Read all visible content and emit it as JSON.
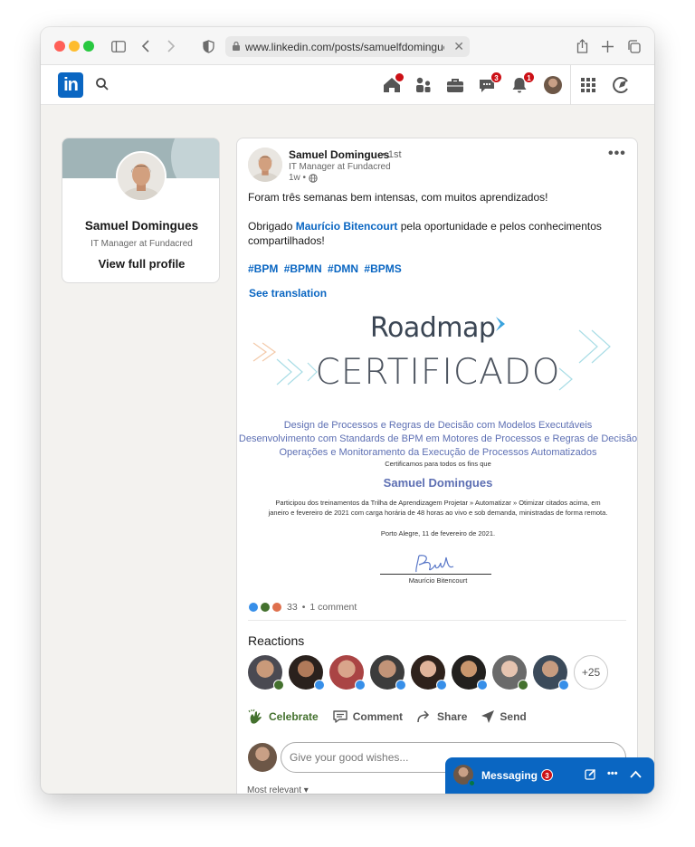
{
  "browser": {
    "url": "www.linkedin.com/posts/samuelfdomingues"
  },
  "nav": {
    "logo": "in",
    "badges": {
      "home": "",
      "messaging": "3",
      "notifications": "1"
    }
  },
  "profile_card": {
    "name": "Samuel Domingues",
    "headline": "IT Manager at Fundacred",
    "view_profile": "View full profile"
  },
  "post": {
    "author_name": "Samuel Domingues",
    "degree": "• 1st",
    "author_headline": "IT Manager at Fundacred",
    "time": "1w •",
    "text_line1": "Foram três semanas bem intensas, com muitos aprendizados!",
    "text_thanks_prefix": "Obrigado ",
    "mention": "Maurício Bitencourt",
    "text_thanks_suffix": " pela oportunidade e pelos conhecimentos",
    "text_thanks_line2": "compartilhados!",
    "hashtags": [
      "#BPM",
      "#BPMN",
      "#DMN",
      "#BPMS"
    ],
    "see_translation": "See translation"
  },
  "certificate": {
    "brand": "Roadmap",
    "title": "CERTIFICADO",
    "course_1": "Design de Processos e Regras de Decisão com Modelos Executáveis",
    "course_2": "Desenvolvimento com Standards de BPM em Motores de Processos e Regras de Decisão",
    "course_3": "Operações e Monitoramento da Execução de Processos Automatizados",
    "intro": "Certificamos para todos os fins que",
    "recipient": "Samuel Domingues",
    "body_1": "Participou dos treinamentos da Trilha de Aprendizagem Projetar » Automatizar » Otimizar citados acima, em",
    "body_2": "janeiro e fevereiro de 2021 com carga horária de 48 horas ao vivo e sob demanda, ministradas de forma remota.",
    "place_date": "Porto Alegre, 11 de fevereiro de 2021.",
    "signer": "Maurício Bitencourt"
  },
  "social": {
    "reaction_count": "33",
    "separator": "•",
    "comments": "1 comment",
    "reactions_heading": "Reactions",
    "more_reactors": "+25"
  },
  "actions": {
    "celebrate": "Celebrate",
    "comment": "Comment",
    "share": "Share",
    "send": "Send"
  },
  "comment_box": {
    "placeholder": "Give your good wishes...",
    "sort": "Most relevant ▾"
  },
  "messaging": {
    "label": "Messaging",
    "badge": "3"
  },
  "colors": {
    "linkedin_blue": "#0a66c2",
    "badge_red": "#cc1016",
    "celebrate_green": "#44712e",
    "cert_blue": "#5d6fb3"
  }
}
